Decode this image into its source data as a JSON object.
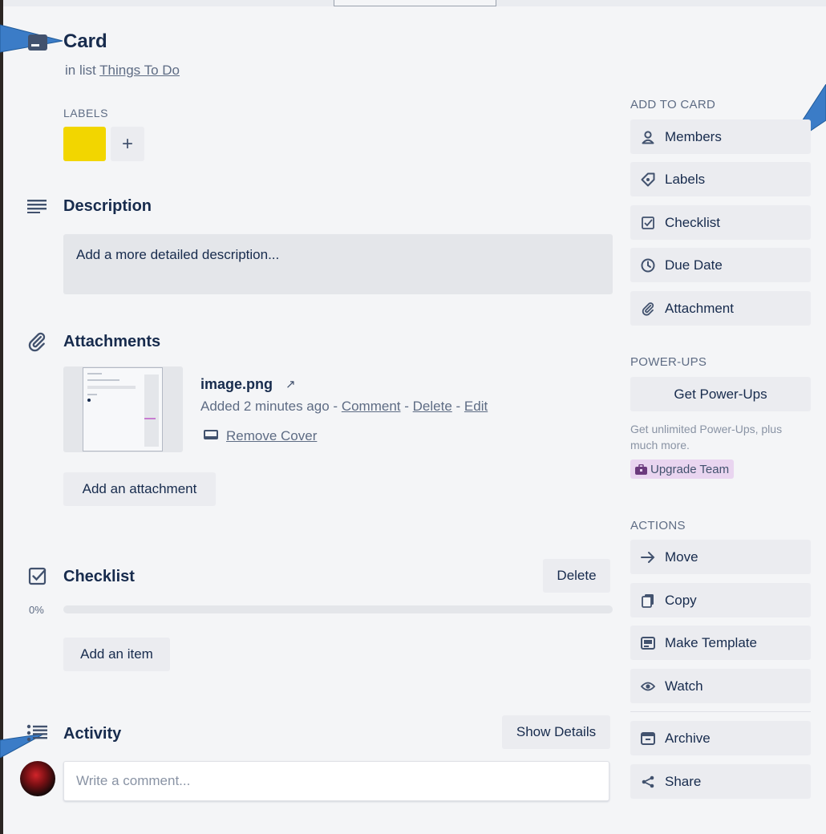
{
  "card": {
    "title": "Card",
    "list_prefix": "in list",
    "list_name": "Things To Do"
  },
  "labels": {
    "heading": "LABELS",
    "items": [
      {
        "color": "#f2d600"
      }
    ],
    "add_glyph": "+"
  },
  "description": {
    "heading": "Description",
    "placeholder": "Add a more detailed description..."
  },
  "attachments": {
    "heading": "Attachments",
    "file_name": "image.png",
    "external_glyph": "↗",
    "added": "Added 2 minutes ago",
    "sep": "-",
    "comment": "Comment",
    "delete": "Delete",
    "edit": "Edit",
    "remove_cover": "Remove Cover",
    "add_button": "Add an attachment"
  },
  "checklist": {
    "heading": "Checklist",
    "delete_button": "Delete",
    "progress_label": "0%",
    "progress_value": 0,
    "add_item_button": "Add an item"
  },
  "activity": {
    "heading": "Activity",
    "show_details_button": "Show Details",
    "comment_placeholder": "Write a comment..."
  },
  "sidebar": {
    "add_to_card": {
      "heading": "ADD TO CARD",
      "items": [
        {
          "label": "Members",
          "icon": "person-icon"
        },
        {
          "label": "Labels",
          "icon": "tag-icon"
        },
        {
          "label": "Checklist",
          "icon": "checkbox-icon"
        },
        {
          "label": "Due Date",
          "icon": "clock-icon"
        },
        {
          "label": "Attachment",
          "icon": "paperclip-icon"
        }
      ]
    },
    "power_ups": {
      "heading": "POWER-UPS",
      "button": "Get Power-Ups",
      "hint": "Get unlimited Power-Ups, plus much more.",
      "upgrade": "Upgrade Team"
    },
    "actions": {
      "heading": "ACTIONS",
      "items": [
        {
          "label": "Move",
          "icon": "arrow-right-icon"
        },
        {
          "label": "Copy",
          "icon": "copy-icon"
        },
        {
          "label": "Make Template",
          "icon": "template-icon"
        },
        {
          "label": "Watch",
          "icon": "eye-icon"
        },
        {
          "label": "Archive",
          "icon": "archive-icon"
        },
        {
          "label": "Share",
          "icon": "share-icon"
        }
      ]
    }
  },
  "colors": {
    "accent_arrow": "#2a6fb5",
    "label_yellow": "#f2d600",
    "upgrade_bg": "#e9d5f0"
  }
}
